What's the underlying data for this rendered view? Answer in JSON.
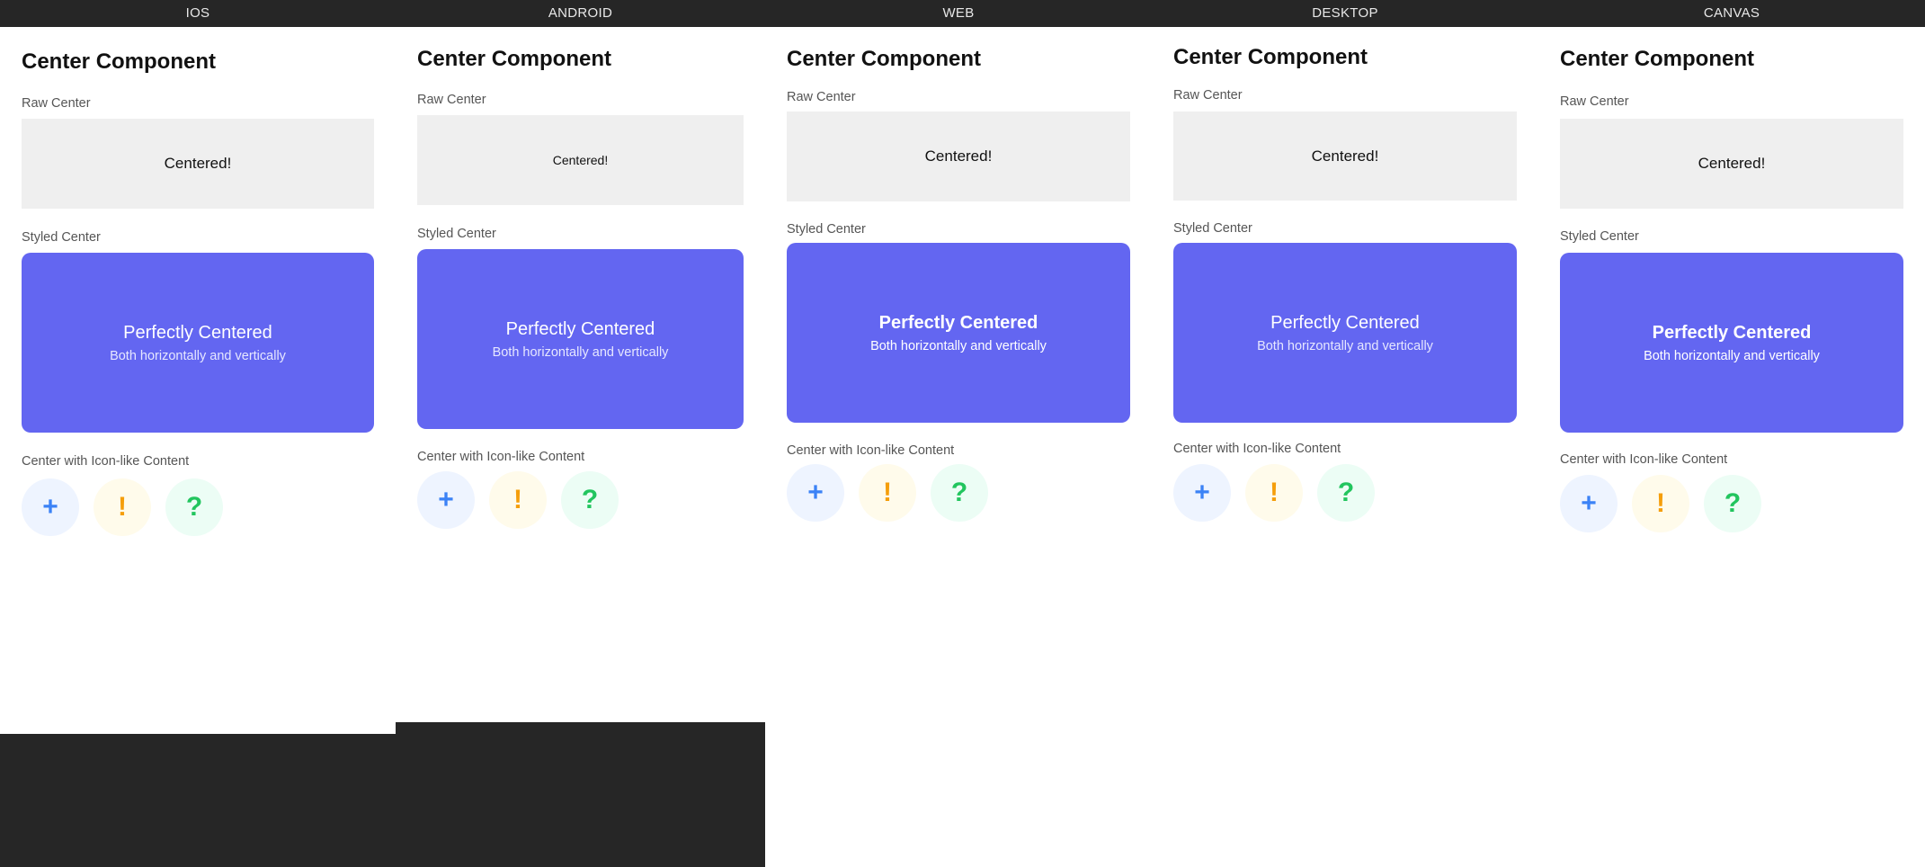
{
  "columns": [
    {
      "platform": "IOS",
      "title": "Center Component",
      "raw_label": "Raw Center",
      "raw_text": "Centered!",
      "styled_label": "Styled Center",
      "styled_title": "Perfectly Centered",
      "styled_subtitle": "Both horizontally and vertically",
      "icon_label": "Center with Icon-like Content",
      "icons": [
        "+",
        "!",
        "?"
      ]
    },
    {
      "platform": "ANDROID",
      "title": "Center Component",
      "raw_label": "Raw Center",
      "raw_text": "Centered!",
      "styled_label": "Styled Center",
      "styled_title": "Perfectly Centered",
      "styled_subtitle": "Both horizontally and vertically",
      "icon_label": "Center with Icon-like Content",
      "icons": [
        "+",
        "!",
        "?"
      ]
    },
    {
      "platform": "WEB",
      "title": "Center Component",
      "raw_label": "Raw Center",
      "raw_text": "Centered!",
      "styled_label": "Styled Center",
      "styled_title": "Perfectly Centered",
      "styled_subtitle": "Both horizontally and vertically",
      "icon_label": "Center with Icon-like Content",
      "icons": [
        "+",
        "!",
        "?"
      ]
    },
    {
      "platform": "DESKTOP",
      "title": "Center Component",
      "raw_label": "Raw Center",
      "raw_text": "Centered!",
      "styled_label": "Styled Center",
      "styled_title": "Perfectly Centered",
      "styled_subtitle": "Both horizontally and vertically",
      "icon_label": "Center with Icon-like Content",
      "icons": [
        "+",
        "!",
        "?"
      ]
    },
    {
      "platform": "CANVAS",
      "title": "Center Component",
      "raw_label": "Raw Center",
      "raw_text": "Centered!",
      "styled_label": "Styled Center",
      "styled_title": "Perfectly Centered",
      "styled_subtitle": "Both horizontally and vertically",
      "icon_label": "Center with Icon-like Content",
      "icons": [
        "+",
        "!",
        "?"
      ]
    }
  ],
  "colors": {
    "styled_background": "#6366f1",
    "raw_background": "#efefef",
    "icon_plus": "#3b82f6",
    "icon_exclaim": "#f59e0b",
    "icon_question": "#22c55e",
    "chrome": "#262626"
  }
}
